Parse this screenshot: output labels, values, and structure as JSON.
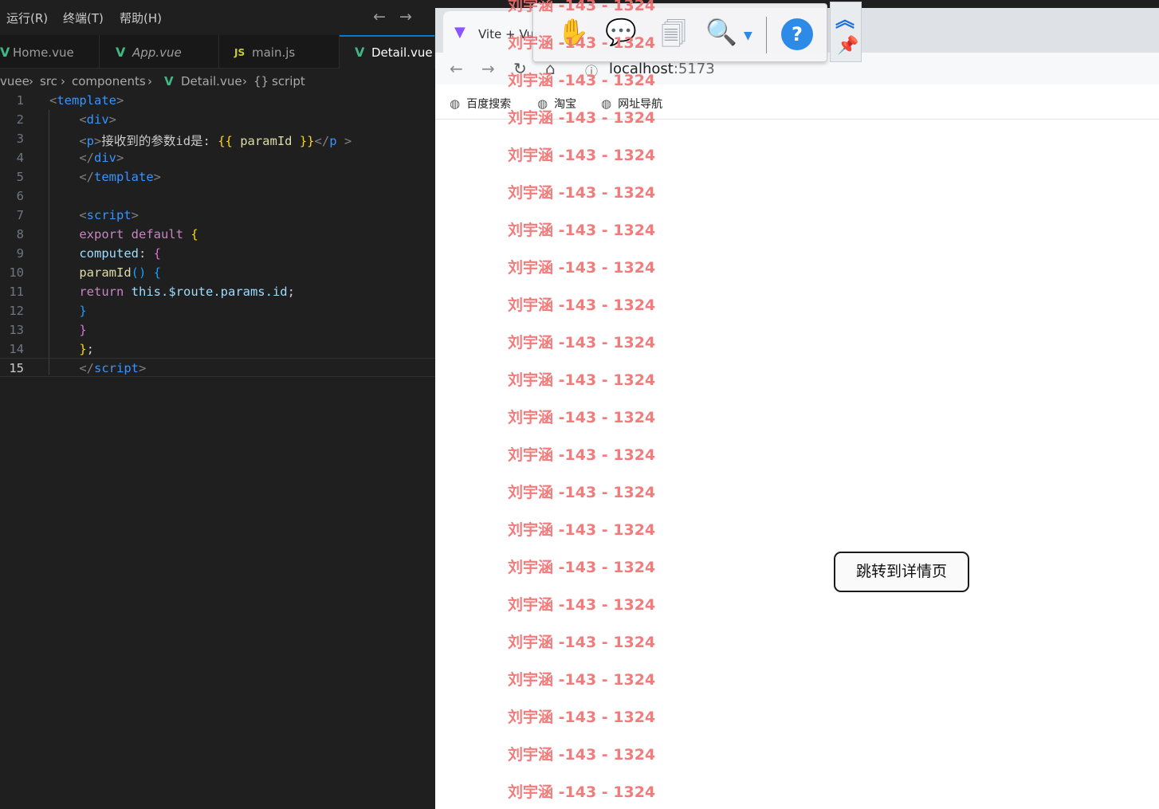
{
  "editor": {
    "menu": [
      "运行(R)",
      "终端(T)",
      "帮助(H)"
    ],
    "tabs": [
      {
        "label": "Home.vue",
        "icon": "vue-icon"
      },
      {
        "label": "App.vue",
        "icon": "vue-icon"
      },
      {
        "label": "main.js",
        "icon": "js-icon"
      },
      {
        "label": "Detail.vue",
        "icon": "vue-icon",
        "active": true
      }
    ],
    "breadcrumb": {
      "seg1": "vuee",
      "seg2": "src",
      "seg3": "components",
      "file": "Detail.vue",
      "symbol": "script"
    },
    "code": {
      "l3_text": "接收到的参数id是: ",
      "l3_expr": "paramId",
      "l11": "this.$route.params.id",
      "line_numbers": [
        "1",
        "2",
        "3",
        "4",
        "5",
        "6",
        "7",
        "8",
        "9",
        "10",
        "11",
        "12",
        "13",
        "14",
        "15"
      ]
    }
  },
  "browser": {
    "tab_title": "Vite + Vue",
    "url_host": "localhost",
    "url_port": ":5173",
    "bookmarks": [
      "百度搜索",
      "淘宝",
      "网址导航"
    ],
    "page": {
      "button_label": "跳转到详情页"
    }
  },
  "watermark": {
    "text": "刘宇涵 -143 - 1324"
  },
  "colors": {
    "editor_bg": "#1f1f1f",
    "accent": "#0078d4",
    "watermark": "#f06e6e",
    "vue_green": "#41b883"
  }
}
